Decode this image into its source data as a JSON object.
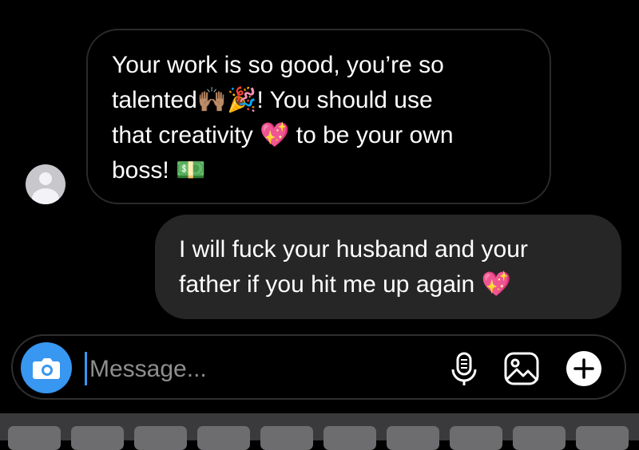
{
  "thread": {
    "messages": [
      {
        "sender": "other",
        "lines": [
          "Your work is so good, you’re so",
          "talented🙌🏽🎉! You should use",
          "that creativity 💖 to be your own",
          "boss! 💵"
        ]
      },
      {
        "sender": "me",
        "lines": [
          "I will fuck your husband and your",
          "father if you hit me up again 💖"
        ]
      }
    ]
  },
  "composer": {
    "placeholder": "Message...",
    "camera_icon": "camera-icon",
    "mic_icon": "microphone-icon",
    "gallery_icon": "image-icon",
    "plus_icon": "plus-icon",
    "accent_color": "#3897f0"
  },
  "colors": {
    "background": "#000000",
    "outgoing_bubble": "#262626",
    "incoming_border": "#2a2a2a",
    "text": "#ffffff",
    "placeholder": "#8e8e8e"
  }
}
